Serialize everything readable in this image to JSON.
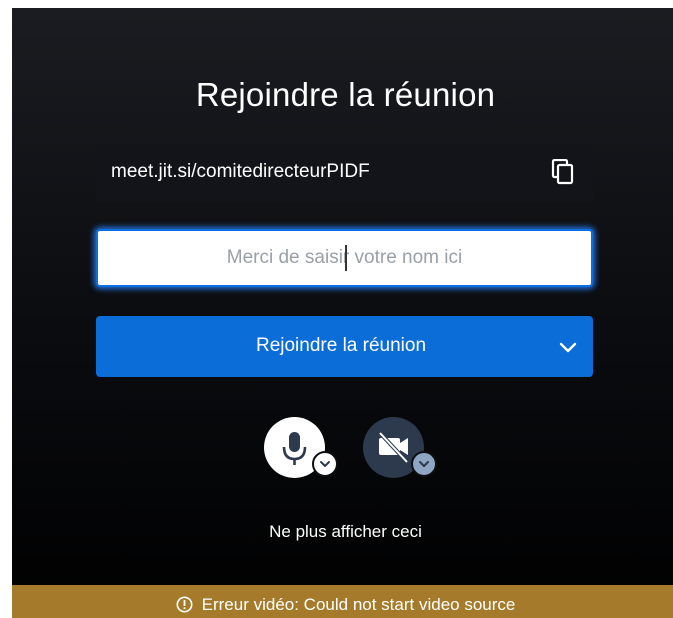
{
  "prejoin": {
    "title": "Rejoindre la réunion",
    "meeting_url": "meet.jit.si/comitedirecteurPIDF",
    "name_placeholder": "Merci de saisir votre nom ici",
    "name_value": "",
    "join_label": "Rejoindre la réunion",
    "dont_show_again": "Ne plus afficher ceci"
  },
  "media": {
    "microphone": "microphone-icon",
    "camera": "camera-off-icon"
  },
  "error": {
    "message": "Erreur vidéo: Could not start video source"
  },
  "colors": {
    "primary": "#0b6dd8",
    "error_bar": "#a57b2b",
    "camera_muted_bg": "#2d3a4d"
  }
}
